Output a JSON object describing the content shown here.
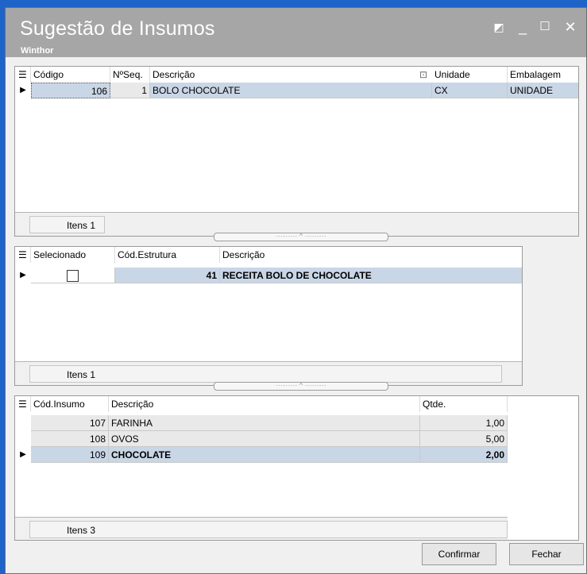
{
  "window": {
    "title": "Sugestão de Insumos",
    "subtitle": "Winthor",
    "buttons": {
      "restore": "◩",
      "minimize": "_",
      "maximize": "☐",
      "close": "✕"
    }
  },
  "grid1": {
    "headers": {
      "codigo": "Código",
      "nseq": "NºSeq.",
      "descricao": "Descrição",
      "unidade": "Unidade",
      "embalagem": "Embalagem"
    },
    "rows": [
      {
        "codigo": "106",
        "nseq": "1",
        "descricao": "BOLO CHOCOLATE",
        "unidade": "CX",
        "embalagem": "UNIDADE"
      }
    ],
    "footer": "Itens 1"
  },
  "grid2": {
    "headers": {
      "selecionado": "Selecionado",
      "cod_estrutura": "Cód.Estrutura",
      "descricao": "Descrição"
    },
    "rows": [
      {
        "selecionado": false,
        "cod_estrutura": "41",
        "descricao": "RECEITA BOLO DE CHOCOLATE"
      }
    ],
    "footer": "Itens 1"
  },
  "grid3": {
    "headers": {
      "cod_insumo": "Cód.Insumo",
      "descricao": "Descrição",
      "qtde": "Qtde."
    },
    "rows": [
      {
        "cod_insumo": "107",
        "descricao": "FARINHA",
        "qtde": "1,00"
      },
      {
        "cod_insumo": "108",
        "descricao": "OVOS",
        "qtde": "5,00"
      },
      {
        "cod_insumo": "109",
        "descricao": "CHOCOLATE",
        "qtde": "2,00"
      }
    ],
    "footer": "Itens 3"
  },
  "actions": {
    "confirm": "Confirmar",
    "close": "Fechar"
  },
  "splitter_glyph": "········· ^ ·········"
}
